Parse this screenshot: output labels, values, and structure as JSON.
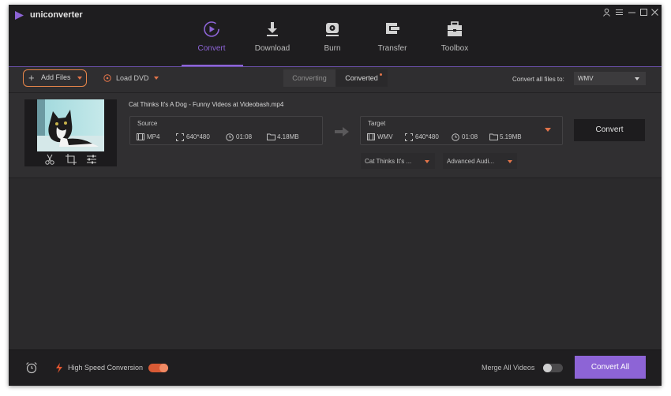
{
  "app": {
    "name": "uniconverter"
  },
  "window_controls": [
    "user-icon",
    "menu-icon",
    "minimize-icon",
    "maximize-icon",
    "close-icon"
  ],
  "nav": [
    {
      "label": "Convert",
      "icon": "convert-icon",
      "active": true
    },
    {
      "label": "Download",
      "icon": "download-icon",
      "active": false
    },
    {
      "label": "Burn",
      "icon": "burn-icon",
      "active": false
    },
    {
      "label": "Transfer",
      "icon": "transfer-icon",
      "active": false
    },
    {
      "label": "Toolbox",
      "icon": "toolbox-icon",
      "active": false
    }
  ],
  "toolbar": {
    "add_files": "Add Files",
    "load_dvd": "Load DVD",
    "tab_converting": "Converting",
    "tab_converted": "Converted",
    "convert_all_label": "Convert all files to:",
    "format_value": "WMV"
  },
  "file": {
    "name": "Cat Thinks It's A Dog - Funny Videos at Videobash.mp4",
    "source": {
      "label": "Source",
      "format": "MP4",
      "resolution": "640*480",
      "duration": "01:08",
      "size": "4.18MB"
    },
    "target": {
      "label": "Target",
      "format": "WMV",
      "resolution": "640*480",
      "duration": "01:08",
      "size": "5.19MB"
    },
    "subtitle_select": "Cat Thinks It's ...",
    "audio_select": "Advanced Audi...",
    "convert_button": "Convert"
  },
  "bottom": {
    "high_speed": "High Speed Conversion",
    "high_speed_on": true,
    "merge_label": "Merge All Videos",
    "merge_on": false,
    "convert_all": "Convert All"
  },
  "colors": {
    "accent": "#8d64d6",
    "orange": "#e8864a",
    "bg": "#2b2a2c"
  }
}
